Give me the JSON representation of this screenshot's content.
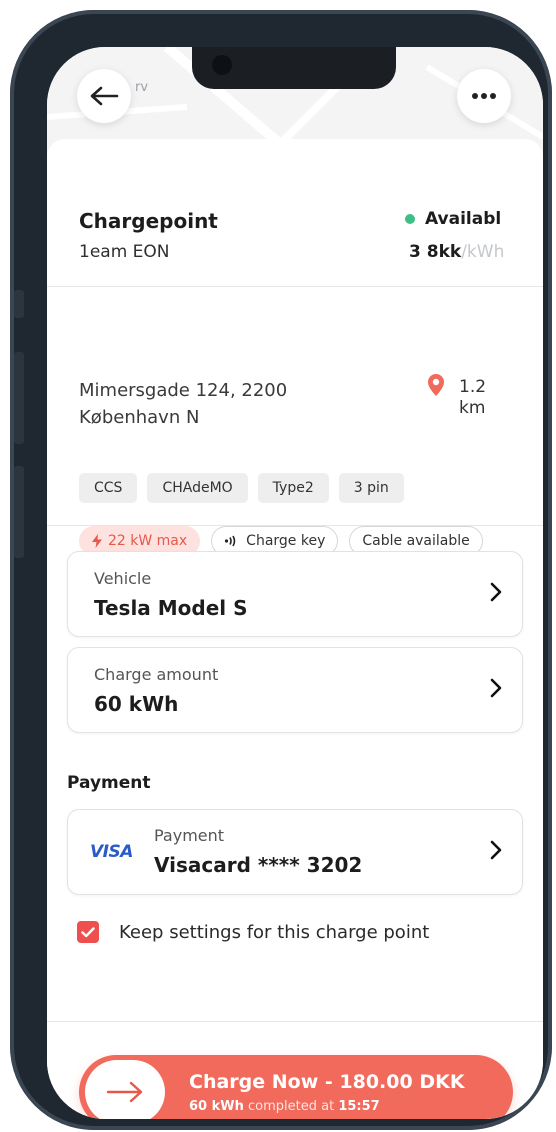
{
  "header": {
    "map_label": "rv",
    "back_icon": "arrow-left-icon",
    "more_icon": "more-horizontal-icon"
  },
  "chargepoint": {
    "title": "Chargepoint",
    "operator": "1eam EON",
    "status": "Availabl",
    "status_color": "#3fbf86",
    "price_value": "3 8kk",
    "price_unit": "/kWh"
  },
  "location": {
    "address_line1": "Mimersgade 124, 2200",
    "address_line2": "København N",
    "distance_value": "1.2",
    "distance_unit": "km",
    "pin_icon": "location-pin-icon"
  },
  "connectors": [
    "CCS",
    "CHAdeMO",
    "Type2",
    "3 pin"
  ],
  "features": {
    "power": "22 kW max",
    "charge_key": "Charge key",
    "cable": "Cable available"
  },
  "vehicle": {
    "label": "Vehicle",
    "value": "Tesla Model S"
  },
  "charge_amount": {
    "label": "Charge amount",
    "value": "60 kWh"
  },
  "payment": {
    "section_title": "Payment",
    "brand": "VISA",
    "label": "Payment",
    "value": "Visacard **** 3202"
  },
  "keep_settings": {
    "checked": true,
    "label": "Keep settings for this charge point"
  },
  "cta": {
    "title": "Charge Now - 180.00 DKK",
    "sub_amount": "60 kWh",
    "sub_text": "completed at",
    "sub_time": "15:57",
    "accent": "#f26a5c"
  }
}
